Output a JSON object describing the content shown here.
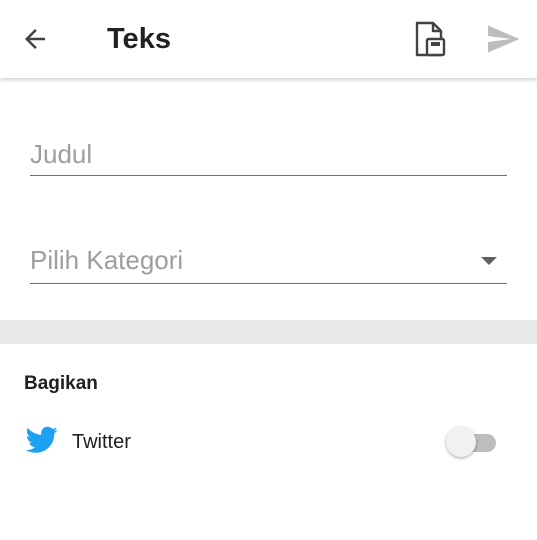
{
  "app_bar": {
    "title": "Teks",
    "back_icon": "arrow-left-icon",
    "draft_icon": "save-draft-icon",
    "send_icon": "send-icon"
  },
  "form": {
    "title_field": {
      "placeholder": "Judul",
      "value": ""
    },
    "category_field": {
      "placeholder": "Pilih Kategori",
      "selected": "",
      "dropdown_icon": "caret-down-icon"
    }
  },
  "share": {
    "section_label": "Bagikan",
    "items": [
      {
        "label": "Twitter",
        "icon": "twitter-icon",
        "enabled": false
      }
    ]
  },
  "colors": {
    "twitter_blue": "#1DA1F2",
    "send_disabled": "#bdbdbd",
    "divider_band": "#e9e9e9"
  }
}
